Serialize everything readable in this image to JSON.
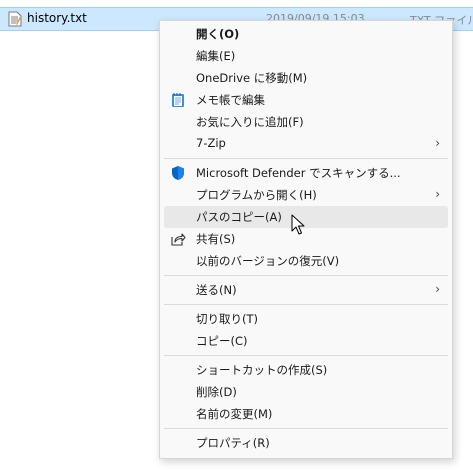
{
  "file": {
    "name": "history.txt",
    "date": "2019/09/19 15:03",
    "type": "TXT ファイル"
  },
  "menu": {
    "open": "開く(O)",
    "edit": "編集(E)",
    "onedrive": "OneDrive に移動(M)",
    "notepad": "メモ帳で編集",
    "favorites": "お気に入りに追加(F)",
    "sevenzip": "7-Zip",
    "defender": "Microsoft Defender でスキャンする...",
    "openwith": "プログラムから開く(H)",
    "copypath": "パスのコピー(A)",
    "share": "共有(S)",
    "restore": "以前のバージョンの復元(V)",
    "sendto": "送る(N)",
    "cut": "切り取り(T)",
    "copy": "コピー(C)",
    "shortcut": "ショートカットの作成(S)",
    "delete": "削除(D)",
    "rename": "名前の変更(M)",
    "properties": "プロパティ(R)"
  },
  "colors": {
    "selection": "#cce8ff",
    "menu_bg": "#f9f9f9",
    "hover": "#e8e8e8",
    "defender_blue": "#0b63c4"
  },
  "hovered_item": "copypath"
}
